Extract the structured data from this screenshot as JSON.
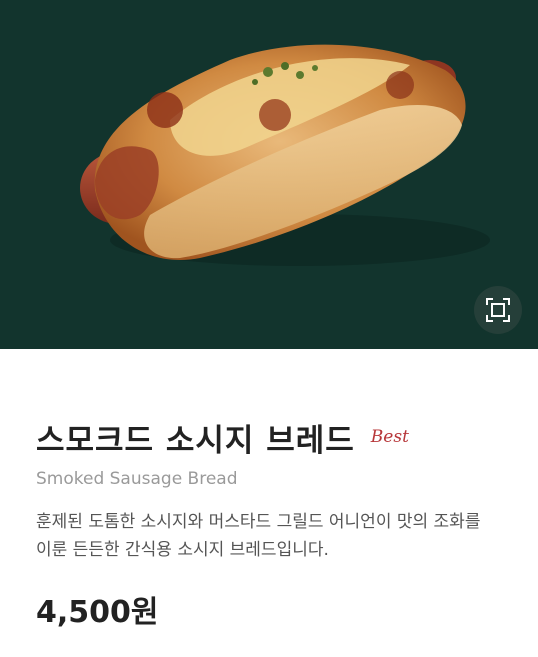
{
  "product": {
    "name_ko": "스모크드 소시지 브레드",
    "badge": "Best",
    "name_en": "Smoked Sausage Bread",
    "description": "훈제된 도톰한 소시지와 머스타드 그릴드 어니언이 맛의 조화를 이룬 든든한 간식용 소시지 브레드입니다.",
    "price": "4,500원"
  },
  "hero": {
    "background_color": "#12342d",
    "image_subject": "smoked-sausage-bread-photo",
    "zoom_icon": "fullscreen-expand-icon"
  },
  "colors": {
    "badge": "#b7373a",
    "subtitle": "#9a9a9a",
    "description": "#555555",
    "title": "#222222"
  }
}
